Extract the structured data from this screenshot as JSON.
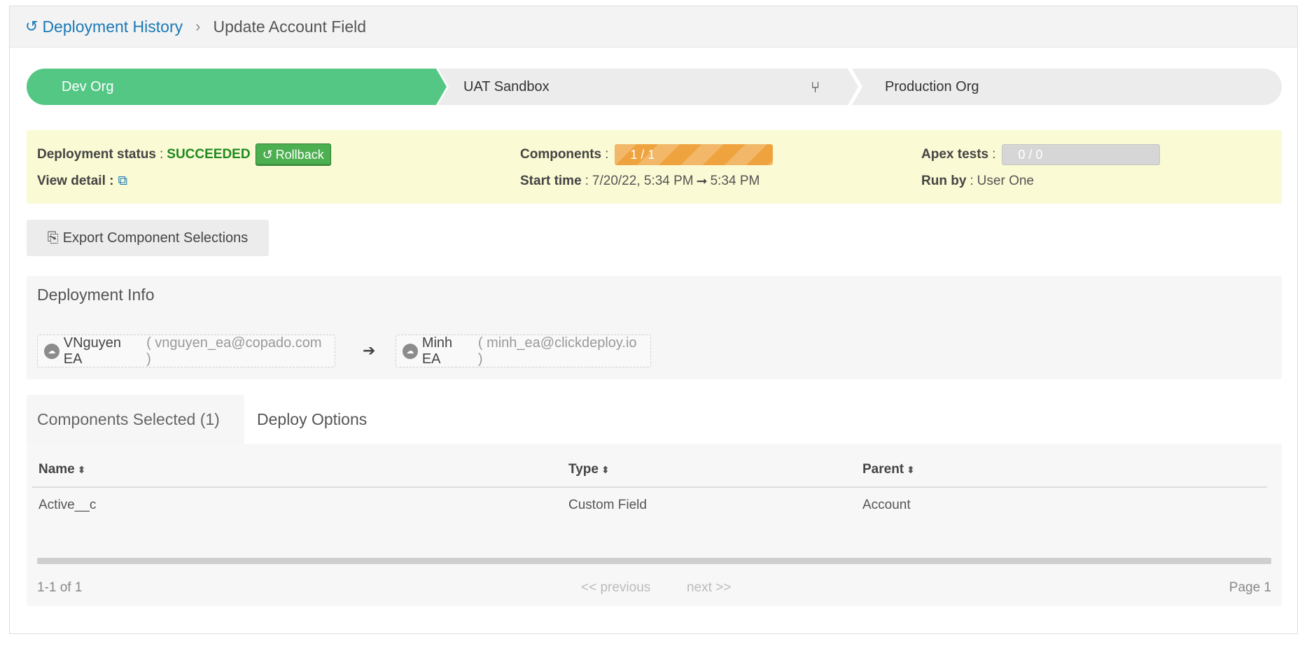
{
  "breadcrumb": {
    "icon": "history-icon",
    "root_label": "Deployment History",
    "separator": "›",
    "current_label": "Update Account Field"
  },
  "stepper": {
    "steps": [
      {
        "label": "Dev Org",
        "state": "complete",
        "color": "#54c785"
      },
      {
        "label": "UAT Sandbox",
        "state": "pending"
      },
      {
        "label": "Production Org",
        "state": "pending"
      }
    ],
    "branch_icon": "⑂"
  },
  "status": {
    "deployment_status_label": "Deployment status",
    "deployment_status_value": "SUCCEEDED",
    "rollback_label": "Rollback",
    "view_detail_label": "View detail :",
    "components_label": "Components",
    "components_value": "1 / 1",
    "components_progress": 1.0,
    "start_time_label": "Start time",
    "start_time_value": "7/20/22, 5:34 PM",
    "end_time_value": "5:34 PM",
    "time_arrow": "➞",
    "apex_tests_label": "Apex tests",
    "apex_tests_value": "0 / 0",
    "run_by_label": "Run by",
    "run_by_value": "User One",
    "colon": ":"
  },
  "export": {
    "label": "Export Component Selections"
  },
  "deployment_info": {
    "title": "Deployment Info",
    "source": {
      "name": "VNguyen EA",
      "email": "( vnguyen_ea@copado.com )"
    },
    "target": {
      "name": "Minh EA",
      "email": "( minh_ea@clickdeploy.io )"
    },
    "arrow": "➔"
  },
  "tabs": [
    {
      "label": "Components Selected (1)",
      "active": true
    },
    {
      "label": "Deploy Options",
      "active": false
    }
  ],
  "table": {
    "columns": [
      "Name",
      "Type",
      "Parent"
    ],
    "sort_glyph": "⬍",
    "rows": [
      {
        "name": "Active__c",
        "type": "Custom Field",
        "parent": "Account"
      }
    ]
  },
  "pagination": {
    "range": "1-1 of 1",
    "previous": "<< previous",
    "next": "next >>",
    "page": "Page 1"
  }
}
